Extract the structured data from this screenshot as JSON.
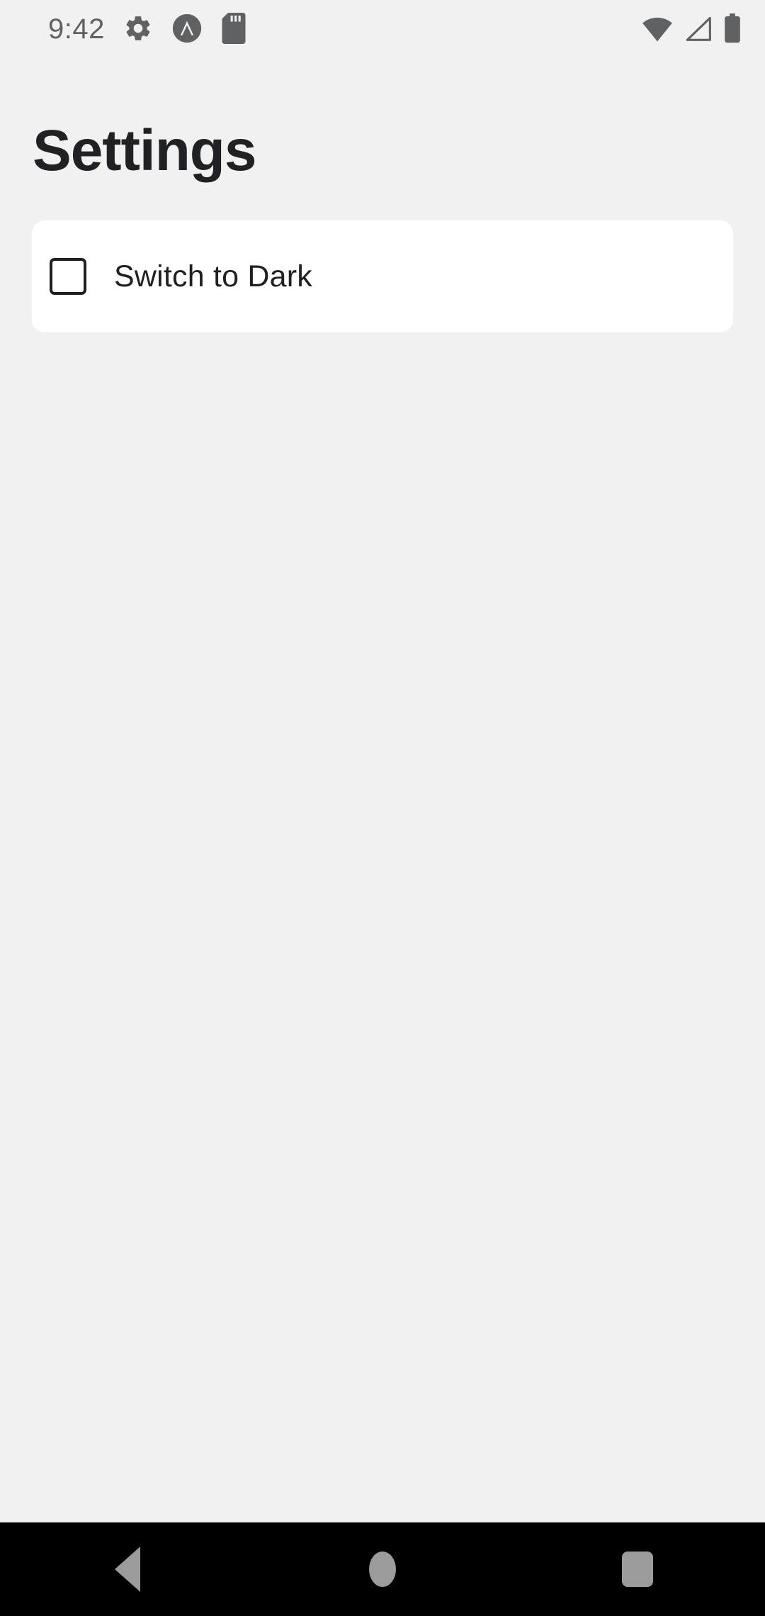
{
  "status_bar": {
    "time": "9:42",
    "left_icons": [
      {
        "name": "gear-icon",
        "label": "Settings"
      },
      {
        "name": "android-emulator-icon",
        "label": "Emulator"
      },
      {
        "name": "sd-card-icon",
        "label": "SD card"
      }
    ],
    "right_icons": [
      {
        "name": "wifi-icon",
        "label": "Wi-Fi"
      },
      {
        "name": "cellular-signal-icon",
        "label": "Mobile signal"
      },
      {
        "name": "battery-icon",
        "label": "Battery full"
      }
    ],
    "icon_color": "#5f6163",
    "background_color": "#f1f1f1"
  },
  "screen": {
    "title": "Settings",
    "background_color": "#f1f1f1",
    "title_color": "#202124"
  },
  "settings_card": {
    "background_color": "#ffffff",
    "corner_radius": "18px",
    "rows": [
      {
        "name": "switch-to-dark",
        "label": "Switch to Dark",
        "control": "checkbox",
        "checked": false,
        "outline_color": "#1f2023",
        "label_color": "#1f2023"
      }
    ]
  },
  "nav_bar": {
    "background_color": "#000000",
    "icon_color": "#9b9b9b",
    "buttons": [
      {
        "name": "back-button",
        "label": "Back"
      },
      {
        "name": "home-button",
        "label": "Home"
      },
      {
        "name": "recents-button",
        "label": "Recent apps"
      }
    ]
  }
}
